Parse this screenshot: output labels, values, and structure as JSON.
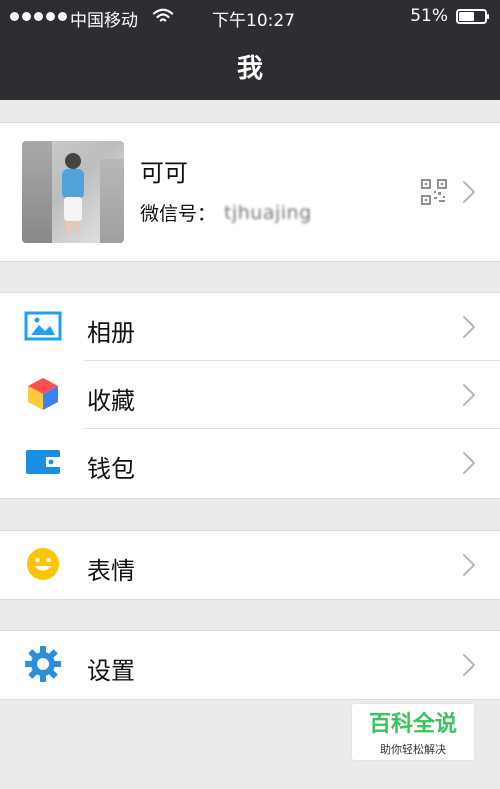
{
  "status_bar": {
    "carrier": "中国移动",
    "time": "下午10:27",
    "battery": "51%"
  },
  "header": {
    "title": "我"
  },
  "profile": {
    "name": "可可",
    "wechat_label": "微信号：",
    "wechat_id": "tjhuajing"
  },
  "menu_groups": [
    {
      "items": [
        {
          "label": "相册",
          "icon": "album-icon"
        },
        {
          "label": "收藏",
          "icon": "favorite-icon"
        },
        {
          "label": "钱包",
          "icon": "wallet-icon"
        }
      ]
    },
    {
      "items": [
        {
          "label": "表情",
          "icon": "sticker-icon"
        }
      ]
    },
    {
      "items": [
        {
          "label": "设置",
          "icon": "settings-icon"
        }
      ]
    }
  ],
  "watermark": {
    "main": "百科全说",
    "sub": "助你轻松解决"
  },
  "colors": {
    "header_bg": "#2e2e32",
    "page_bg": "#ebebeb",
    "album_blue": "#1da1f2",
    "favorite_red": "#ff4f4f",
    "favorite_yellow": "#ffc940",
    "favorite_blue": "#3b82f6",
    "wallet_blue": "#1a8fe3",
    "sticker_yellow": "#ffc400",
    "settings_blue": "#2b8dde",
    "watermark_green": "#39c35d"
  }
}
